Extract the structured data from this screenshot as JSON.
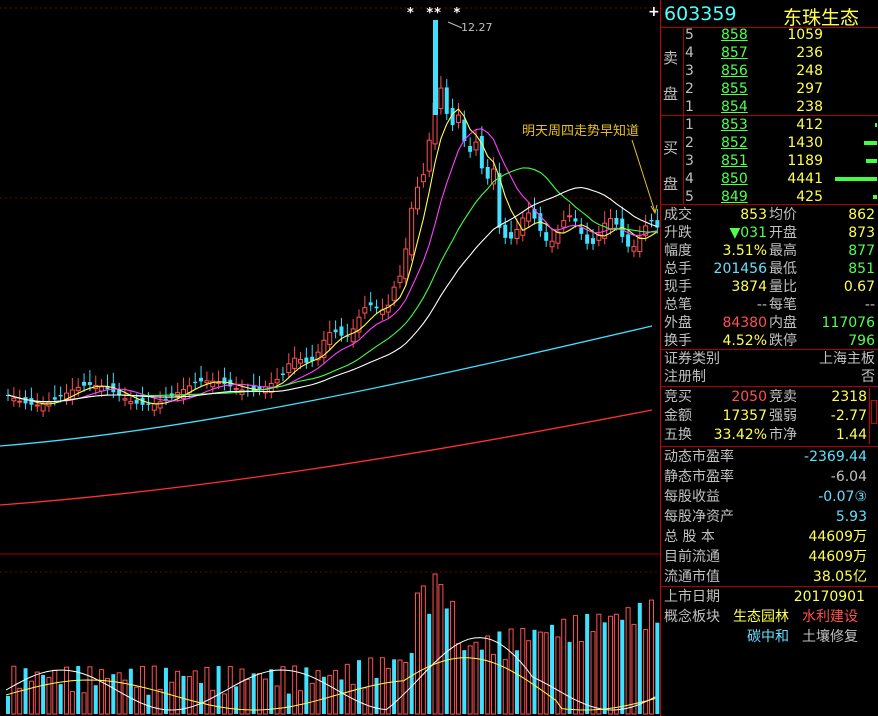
{
  "header": {
    "plus_icon": "+",
    "code": "603359",
    "name": "东珠生态"
  },
  "chart": {
    "peak_label": "12.27",
    "annotation": "明天周四走势早知道",
    "stars": [
      "*",
      "**",
      "*"
    ]
  },
  "order_book": {
    "sell_side_label": [
      "卖",
      "盘"
    ],
    "buy_side_label": [
      "买",
      "盘"
    ],
    "sell": [
      {
        "level": "5",
        "price": "858",
        "volume": "1059"
      },
      {
        "level": "4",
        "price": "857",
        "volume": "236"
      },
      {
        "level": "3",
        "price": "856",
        "volume": "248"
      },
      {
        "level": "2",
        "price": "855",
        "volume": "297"
      },
      {
        "level": "1",
        "price": "854",
        "volume": "238"
      }
    ],
    "buy": [
      {
        "level": "1",
        "price": "853",
        "volume": "412",
        "bar": 0.01
      },
      {
        "level": "2",
        "price": "852",
        "volume": "1430",
        "bar": 0.32
      },
      {
        "level": "3",
        "price": "851",
        "volume": "1189",
        "bar": 0.27
      },
      {
        "level": "4",
        "price": "850",
        "volume": "4441",
        "bar": 1.0
      },
      {
        "level": "5",
        "price": "849",
        "volume": "425",
        "bar": 0.1
      }
    ]
  },
  "quote": [
    {
      "l1": "成交",
      "v1": "853",
      "l2": "均价",
      "v2": "862"
    },
    {
      "l1": "升跌",
      "v1": "▼031",
      "l2": "开盘",
      "v2": "873"
    },
    {
      "l1": "幅度",
      "v1": "3.51%",
      "l2": "最高",
      "v2": "877"
    },
    {
      "l1": "总手",
      "v1": "201456",
      "l2": "最低",
      "v2": "851"
    },
    {
      "l1": "现手",
      "v1": "3874",
      "l2": "量比",
      "v2": "0.67"
    },
    {
      "l1": "总笔",
      "v1": "--",
      "l2": "每笔",
      "v2": "--"
    },
    {
      "l1": "外盘",
      "v1": "84380",
      "l2": "内盘",
      "v2": "117076"
    },
    {
      "l1": "换手",
      "v1": "4.52%",
      "l2": "跌停",
      "v2": "796"
    }
  ],
  "security_type": {
    "label": "证券类别",
    "value": "上海主板"
  },
  "registration": {
    "label": "注册制",
    "value": "否"
  },
  "auction": [
    {
      "l1": "竞买",
      "v1": "2050",
      "l2": "竞卖",
      "v2": "2318"
    },
    {
      "l1": "金额",
      "v1": "17357",
      "l2": "强弱",
      "v2": "-2.77"
    },
    {
      "l1": "五换",
      "v1": "33.42%",
      "l2": "市净",
      "v2": "1.44"
    }
  ],
  "fundamentals": [
    {
      "label": "动态市盈率",
      "value": "-2369.44"
    },
    {
      "label": "静态市盈率",
      "value": "-6.04"
    },
    {
      "label": "每股收益",
      "value": "-0.07③"
    },
    {
      "label": "每股净资产",
      "value": "5.93"
    },
    {
      "label": "总 股 本",
      "value": "44609万"
    },
    {
      "label": "目前流通",
      "value": "44609万"
    },
    {
      "label": "流通市值",
      "value": "38.05亿"
    }
  ],
  "listing": {
    "label": "上市日期",
    "value": "20170901"
  },
  "concepts": {
    "label": "概念板块",
    "items": [
      "生态园林",
      "水利建设",
      "碳中和",
      "土壤修复"
    ]
  }
}
